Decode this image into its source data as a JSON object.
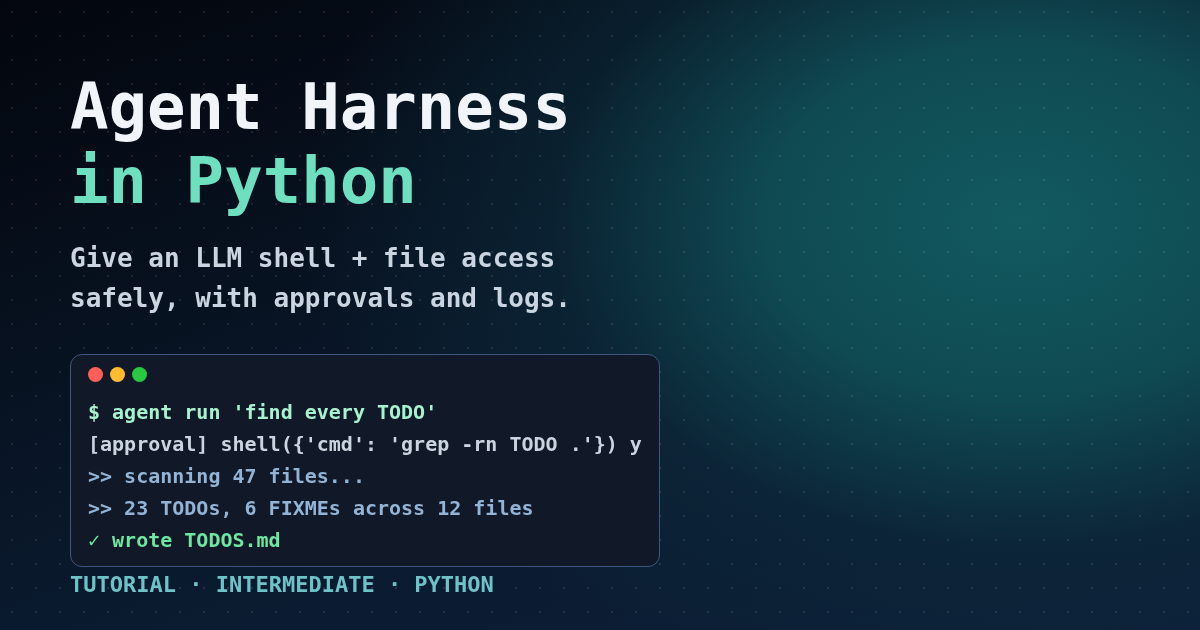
{
  "title": {
    "line_1": "Agent Harness",
    "line_2": "in Python"
  },
  "subtitle": [
    "Give an LLM shell + file access",
    "safely, with approvals and logs."
  ],
  "terminal": {
    "lines": [
      {
        "kind": "command",
        "text": "$ agent run 'find every TODO'"
      },
      {
        "kind": "approval",
        "text": "[approval] shell({'cmd': 'grep -rn TODO .'}) y"
      },
      {
        "kind": "output",
        "text": ">> scanning 47 files..."
      },
      {
        "kind": "output",
        "text": ">> 23 TODOs, 6 FIXMEs across 12 files"
      },
      {
        "kind": "success",
        "text": "✓ wrote TODOS.md"
      }
    ]
  },
  "footer": "TUTORIAL · INTERMEDIATE · PYTHON"
}
